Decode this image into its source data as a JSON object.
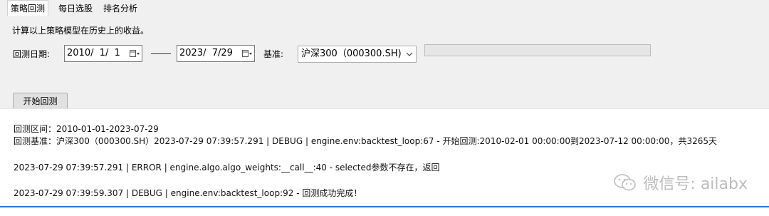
{
  "tabs": [
    {
      "label": "策略回测",
      "active": true
    },
    {
      "label": "每日选股",
      "active": false
    },
    {
      "label": "排名分析",
      "active": false
    }
  ],
  "description": "计算以上策略模型在历史上的收益。",
  "backtest": {
    "date_label": "回测日期:",
    "start_date": "2010/  1/  1",
    "end_date": "2023/  7/29",
    "benchmark_label": "基准:",
    "benchmark_value": "沪深300（000300.SH)",
    "progress": 0,
    "start_button": "开始回测"
  },
  "log": {
    "lines": [
      "回测区间：2010-01-01-2023-07-29",
      "回测基准：沪深300（000300.SH）2023-07-29 07:39:57.291 | DEBUG    | engine.env:backtest_loop:67 - 开始回测:2010-02-01 00:00:00到2023-07-12 00:00:00，共3265天",
      "2023-07-29 07:39:57.291 | ERROR    | engine.algo.algo_weights:__call__:40 - selected参数不存在，返回",
      "2023-07-29 07:39:59.307 | DEBUG    | engine.env:backtest_loop:92 - 回测成功完成！"
    ]
  },
  "watermark": "微信号: ailabx",
  "colors": {
    "accent": "#2b78c8",
    "panel_bg": "#f0f0f0",
    "progress_fill": "#06b025"
  }
}
